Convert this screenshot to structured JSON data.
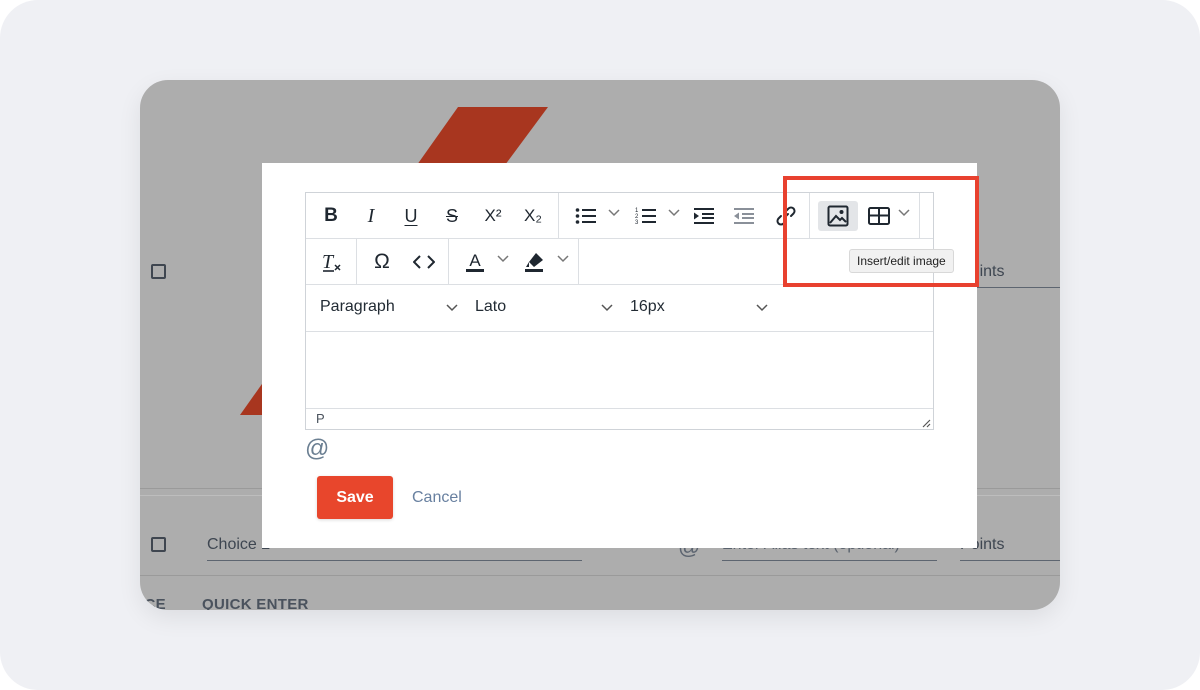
{
  "background": {
    "row1_points": "Points",
    "row2_choice": "Choice 2",
    "row2_alias_placeholder": "Enter Alias text (optional)",
    "row2_points": "Points",
    "footer_left": "ICE",
    "footer_quick_enter": "QUICK ENTER",
    "accent_color": "#c0391e"
  },
  "toolbar": {
    "bold": "B",
    "italic": "I",
    "underline": "U",
    "strikethrough": "S",
    "superscript": "X²",
    "subscript": "X₂",
    "block_format": "Paragraph",
    "font_family": "Lato",
    "font_size": "16px"
  },
  "statusbar": {
    "path": "P"
  },
  "tooltip": {
    "text": "Insert/edit image"
  },
  "mention": "@",
  "actions": {
    "save": "Save",
    "cancel": "Cancel",
    "save_color": "#e8462c"
  }
}
